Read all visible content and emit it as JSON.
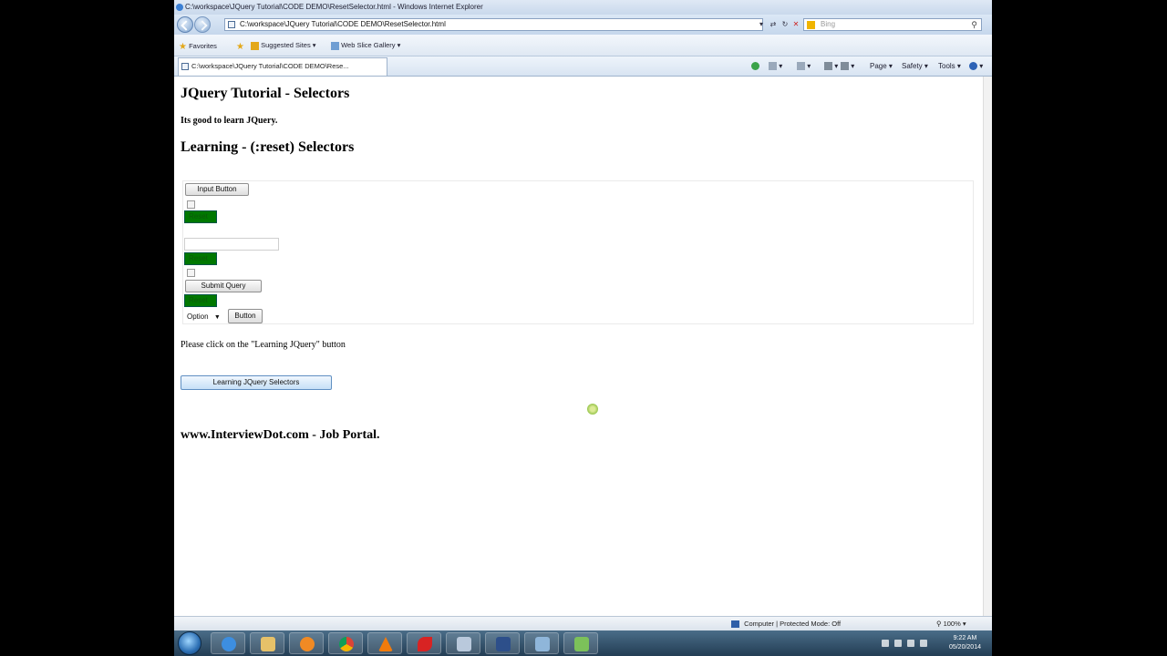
{
  "window": {
    "title": "C:\\workspace\\JQuery Tutorial\\CODE DEMO\\ResetSelector.html - Windows Internet Explorer"
  },
  "browser": {
    "address": "C:\\workspace\\JQuery Tutorial\\CODE DEMO\\ResetSelector.html",
    "search_placeholder": "Bing",
    "favorites": {
      "favorites_label": "Favorites",
      "suggested_sites": "Suggested Sites ▾",
      "web_slice_gallery": "Web Slice Gallery ▾"
    },
    "tab_title": "C:\\workspace\\JQuery Tutorial\\CODE DEMO\\Rese...",
    "commands": {
      "page": "Page ▾",
      "safety": "Safety ▾",
      "tools": "Tools ▾"
    },
    "status": {
      "zone": "Computer | Protected Mode: Off",
      "zoom": "100%"
    }
  },
  "page": {
    "title": "JQuery Tutorial - Selectors",
    "intro": "Its good to learn JQuery.",
    "heading": "Learning - (:reset) Selectors",
    "form": {
      "input_button": "Input Button",
      "reset_1": "Reset",
      "reset_2": "Reset",
      "submit_query": "Submit Query",
      "reset_3": "Reset",
      "select_value": "Option",
      "button": "Button"
    },
    "instruction": "Please click on the \"Learning JQuery\" button",
    "action_button": "Learning JQuery Selectors",
    "footer": "www.InterviewDot.com - Job Portal."
  },
  "taskbar": {
    "time": "9:22 AM",
    "date": "05/20/2014"
  },
  "colors": {
    "reset_bg": "#007800",
    "reset_text": "#0a5a0a"
  }
}
